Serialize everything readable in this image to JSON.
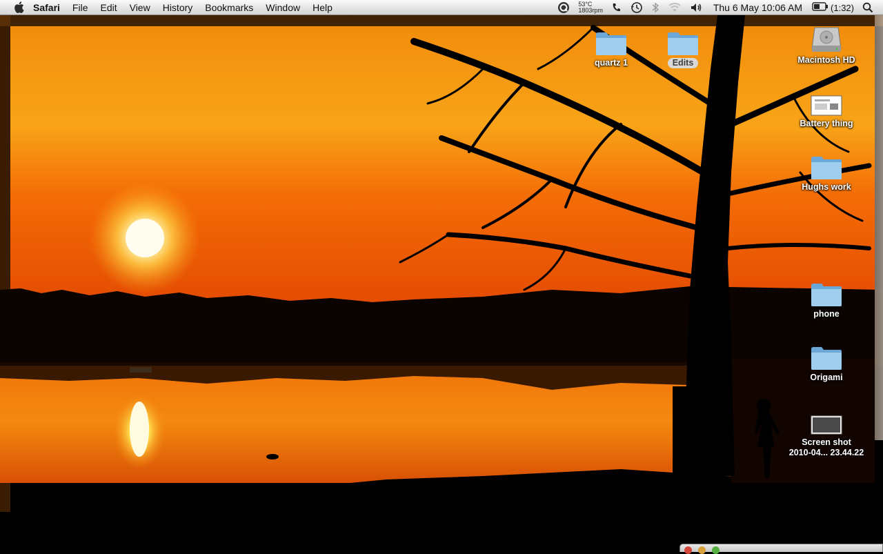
{
  "menubar": {
    "app_name": "Safari",
    "menus": [
      "File",
      "Edit",
      "View",
      "History",
      "Bookmarks",
      "Window",
      "Help"
    ],
    "temperature": "53°C",
    "fan_speed": "1803rpm",
    "clock": "Thu 6 May  10:06 AM",
    "battery": "(1:32)"
  },
  "desktop": {
    "icons": {
      "quartz": "quartz 1",
      "edits": "Edits",
      "macintosh_hd": "Macintosh HD",
      "battery_thing": "Battery thing",
      "hughs_work": "Hughs work",
      "phone": "phone",
      "origami": "Origami",
      "screenshot_line1": "Screen shot",
      "screenshot_line2": "2010-04... 23.44.22"
    }
  },
  "colors": {
    "folder_blue": "#8fc2e8",
    "sky_top": "#f08a0a",
    "sun": "#fff6c8",
    "selection_gray": "#d9d9d9"
  }
}
